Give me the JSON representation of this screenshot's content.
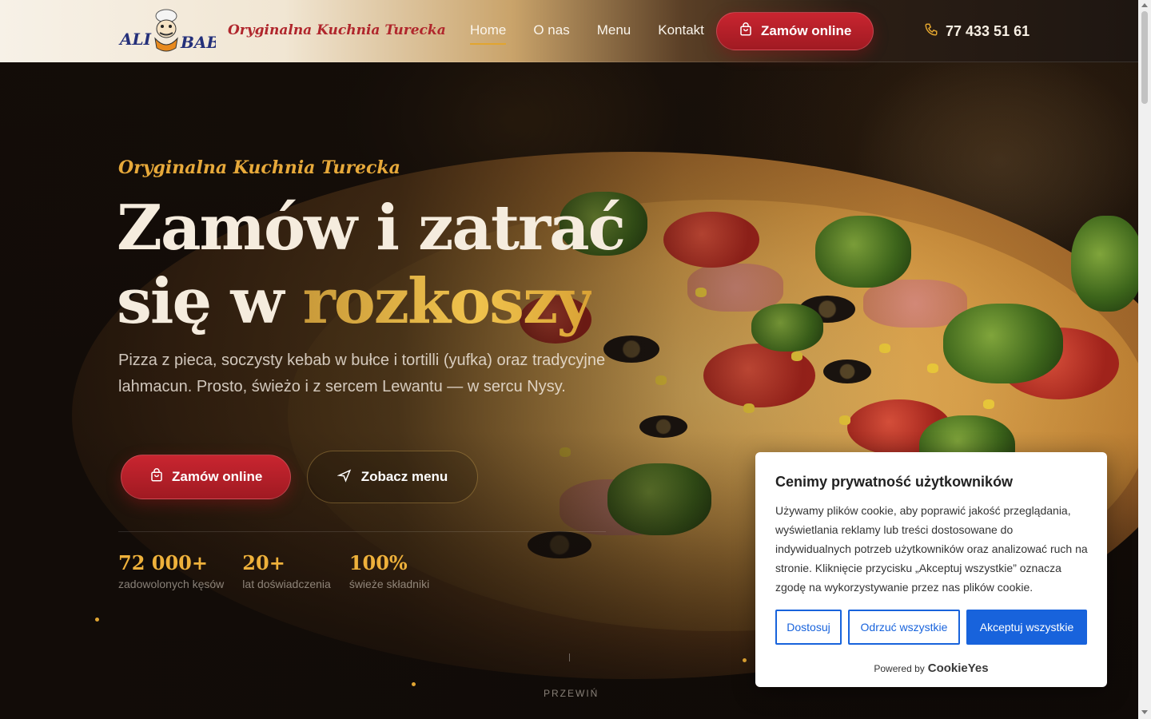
{
  "header": {
    "logo_alt": "Ali Baba",
    "tagline": "Oryginalna Kuchnia Turecka",
    "nav": [
      {
        "label": "Home",
        "active": true
      },
      {
        "label": "O nas",
        "active": false
      },
      {
        "label": "Menu",
        "active": false
      },
      {
        "label": "Kontakt",
        "active": false
      }
    ],
    "order_button": "Zamów online",
    "order_icon": "shopping-bag-icon",
    "phone_icon": "phone-icon",
    "phone": "77 433 51 61"
  },
  "hero": {
    "kicker": "Oryginalna Kuchnia Turecka",
    "headline_line1": "Zamów i zatrać",
    "headline_line2_start": "się w ",
    "headline_highlight": "rozkoszy",
    "lead": "Pizza z pieca, soczysty kebab w bułce i tortilli (yufka) oraz tradycyjne lahmacun. Prosto, świeżo i z sercem Lewantu — w sercu Nysy.",
    "primary_button": "Zamów online",
    "secondary_button": "Zobacz menu",
    "secondary_icon": "send-icon",
    "stats": [
      {
        "value": "72 000+",
        "label": "zadowolonych kęsów"
      },
      {
        "value": "20+",
        "label": "lat doświadczenia"
      },
      {
        "value": "100%",
        "label": "świeże składniki"
      }
    ],
    "scroll_label": "PRZEWIŃ"
  },
  "cookie_banner": {
    "title": "Cenimy prywatność użytkowników",
    "text": "Używamy plików cookie, aby poprawić jakość przeglądania, wyświetlania reklamy lub treści dostosowane do indywidualnych potrzeb użytkowników oraz analizować ruch na stronie. Kliknięcie przycisku „Akceptuj wszystkie” oznacza zgodę na wykorzystywanie przez nas plików cookie.",
    "customize": "Dostosuj",
    "reject": "Odrzuć wszystkie",
    "accept": "Akceptuj wszystkie",
    "powered_by": "Powered by",
    "brand": "CookieYes"
  },
  "colors": {
    "accent_gold": "#e7a93a",
    "brand_red": "#b0262c",
    "cookie_blue": "#1863dc"
  }
}
